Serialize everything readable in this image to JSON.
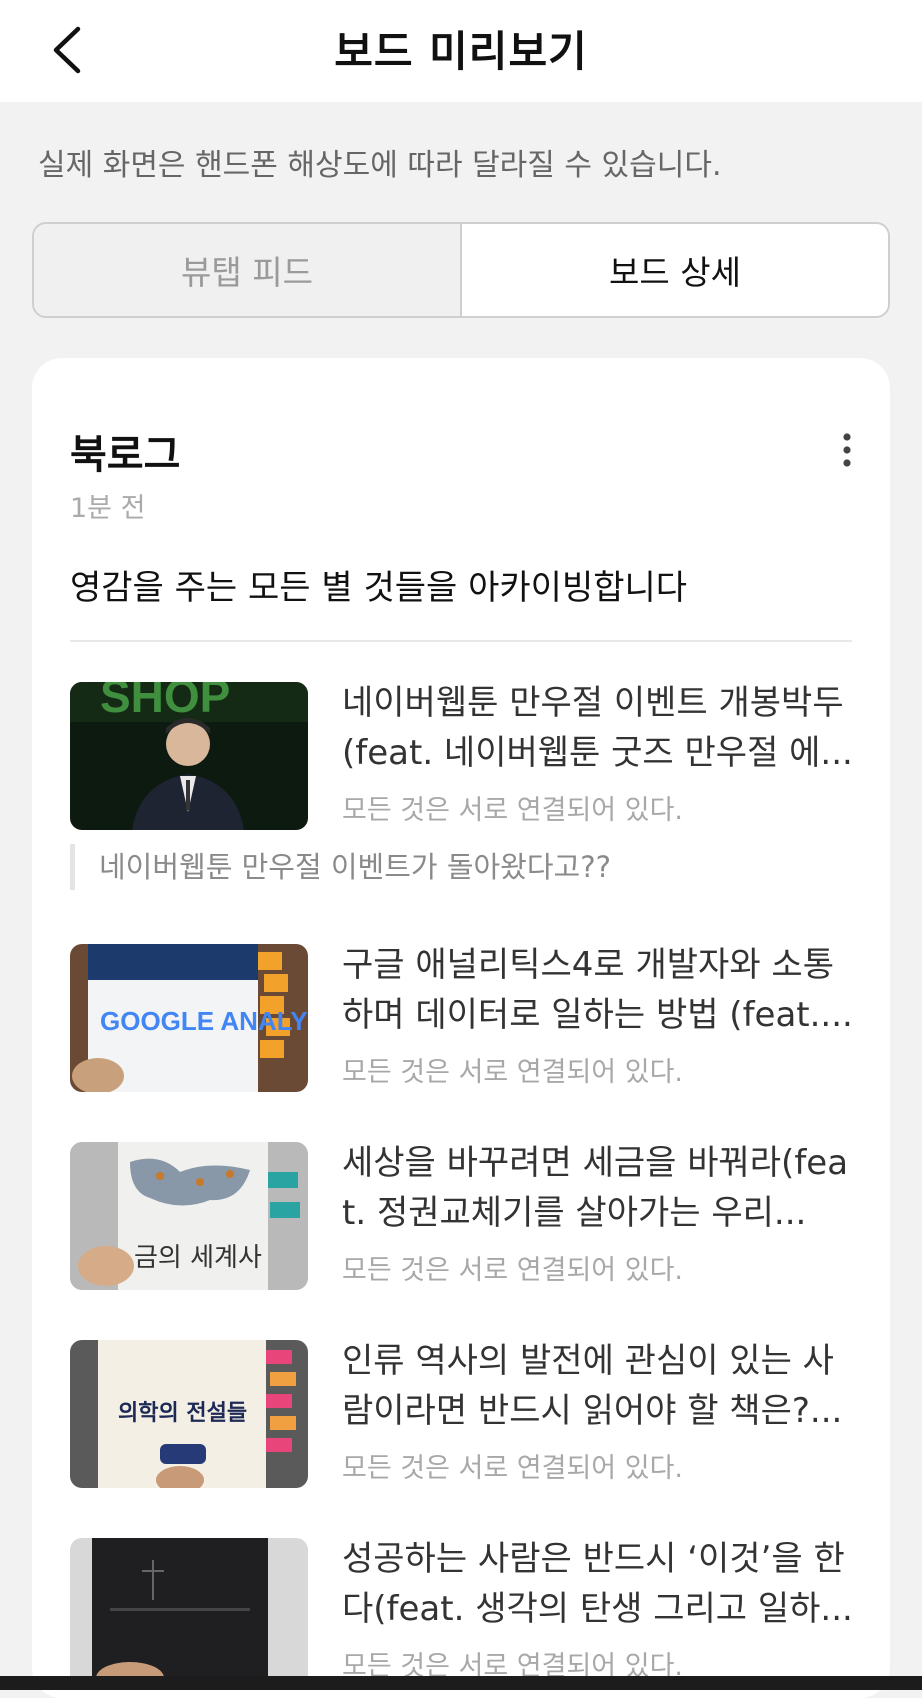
{
  "header": {
    "title": "보드 미리보기",
    "back_icon": "chevron-left-icon"
  },
  "notice": "실제 화면은 핸드폰 해상도에 따라 달라질 수 있습니다.",
  "tabs": [
    {
      "label": "뷰탭 피드",
      "active": false
    },
    {
      "label": "보드 상세",
      "active": true
    }
  ],
  "board": {
    "name": "북로그",
    "time_ago": "1분 전",
    "description": "영감을 주는 모든 별 것들을 아카이빙합니다",
    "more_icon": "more-vertical-icon"
  },
  "posts": [
    {
      "title": "네이버웹툰 만우절 이벤트 개봉박두(feat. 네이버웹툰 굿즈 만우절 에...",
      "source": "모든 것은 서로 연결되어 있다.",
      "quote": "네이버웹툰 만우절 이벤트가 돌아왔다고??",
      "thumb_text": "SHOP"
    },
    {
      "title": "구글 애널리틱스4로 개발자와 소통하며 데이터로 일하는 방법 (feat....",
      "source": "모든 것은 서로 연결되어 있다.",
      "thumb_text": "GOOGLE ANALY"
    },
    {
      "title": "세상을 바꾸려면 세금을 바꿔라(feat. 정권교체기를 살아가는 우리...",
      "source": "모든 것은 서로 연결되어 있다.",
      "thumb_text": "금의 세계사"
    },
    {
      "title": "인류 역사의 발전에 관심이 있는 사람이라면 반드시 읽어야 할 책은?...",
      "source": "모든 것은 서로 연결되어 있다.",
      "thumb_text": "의학의 전설들"
    },
    {
      "title": "성공하는 사람은 반드시 ‘이것’을 한다(feat. 생각의 탄생 그리고 일하...",
      "source": "모든 것은 서로 연결되어 있다."
    }
  ]
}
